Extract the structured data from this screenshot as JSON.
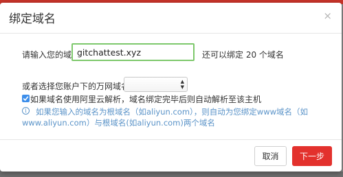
{
  "dialog": {
    "title": "绑定域名",
    "close_glyph": "×"
  },
  "form": {
    "domain_label": "请输入您的域名:",
    "domain_value": "gitchattest.xyz",
    "remaining_text": "还可以绑定 20 个域名",
    "account_label": "或者选择您账户下的万网域名:",
    "select_value": "",
    "auto_resolve_checked": true,
    "auto_resolve_label": "如果域名使用阿里云解析，域名绑定完毕后则自动解析至该主机"
  },
  "info": {
    "icon": "info-icon",
    "line1": "如果您输入的域名为根域名（如aliyun.com），则自动为您绑定www域名（如",
    "line2": "www.aliyun.com）与根域名(如aliyun.com)两个域名"
  },
  "footer": {
    "cancel_label": "取消",
    "next_label": "下一步"
  },
  "colors": {
    "accent_red": "#e3312d",
    "info_blue": "#5a93c8",
    "input_focus_green": "#7dc86b",
    "checkbox_blue": "#3d8eea"
  }
}
